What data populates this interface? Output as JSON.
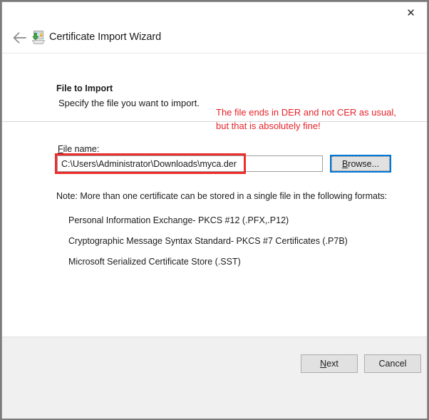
{
  "window": {
    "title": "Certificate Import Wizard",
    "title_icon": "certificate-import-icon",
    "close_label": "✕",
    "back_label": "←"
  },
  "page": {
    "heading": "File to Import",
    "subheading": "Specify the file you want to import.",
    "annotation": "The file ends in DER and not CER as usual, but that is absolutely fine!",
    "annotation_color": "#e8222a",
    "field_label_prefix": "F",
    "field_label_rest": "ile name:",
    "file_name_value": "C:\\Users\\Administrator\\Downloads\\myca.der",
    "file_name_placeholder": "",
    "browse_accel": "B",
    "browse_rest": "rowse...",
    "note": "Note:  More than one certificate can be stored in a single file in the following formats:",
    "formats": [
      "Personal Information Exchange- PKCS #12 (.PFX,.P12)",
      "Cryptographic Message Syntax Standard- PKCS #7 Certificates (.P7B)",
      "Microsoft Serialized Certificate Store (.SST)"
    ]
  },
  "footer": {
    "next_accel": "N",
    "next_rest": "ext",
    "cancel_label": "Cancel"
  }
}
